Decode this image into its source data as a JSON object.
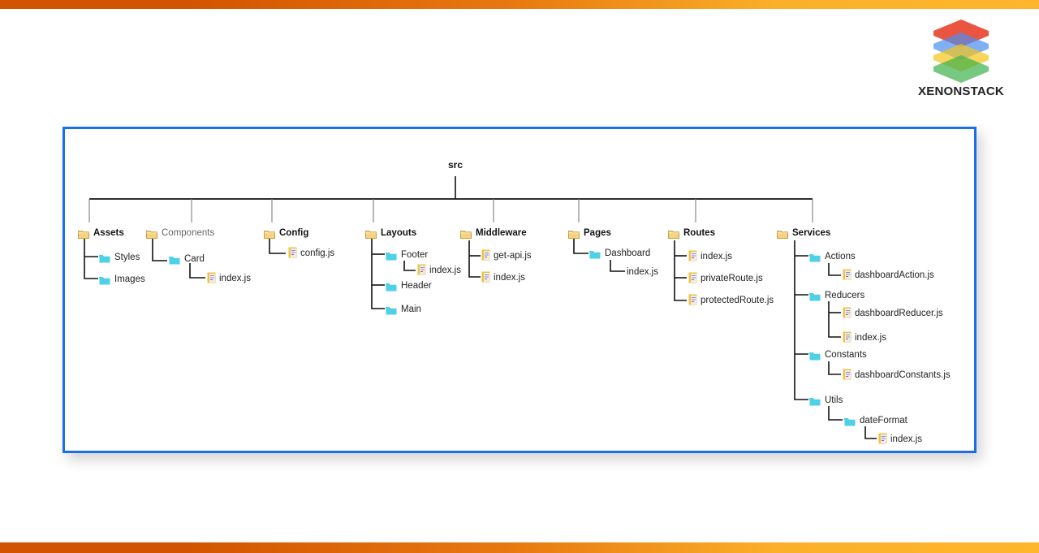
{
  "brand": {
    "name": "XENONSTACK",
    "logo_layers": [
      "#e8432e",
      "#4c8df0",
      "#f5c518",
      "#3db04a"
    ]
  },
  "colors": {
    "frame_border": "#1a6fe8",
    "folder_root": "#f6d27a",
    "folder_sub": "#4dd0e8",
    "file_icon": "#f3c23c",
    "gradient_start": "#d35400",
    "gradient_end": "#ffb52c"
  },
  "tree": {
    "root": "src",
    "nodes": [
      {
        "id": "assets",
        "label": "Assets",
        "type": "folder-root",
        "style": "bold"
      },
      {
        "id": "assets-styles",
        "label": "Styles",
        "type": "folder"
      },
      {
        "id": "assets-images",
        "label": "Images",
        "type": "folder"
      },
      {
        "id": "components",
        "label": "Components",
        "type": "folder-root",
        "style": "muted"
      },
      {
        "id": "components-card",
        "label": "Card",
        "type": "folder"
      },
      {
        "id": "components-card-index",
        "label": "index.js",
        "type": "file"
      },
      {
        "id": "config",
        "label": "Config",
        "type": "folder-root",
        "style": "bold"
      },
      {
        "id": "config-configjs",
        "label": "config.js",
        "type": "file"
      },
      {
        "id": "layouts",
        "label": "Layouts",
        "type": "folder-root",
        "style": "bold"
      },
      {
        "id": "layouts-footer",
        "label": "Footer",
        "type": "folder"
      },
      {
        "id": "layouts-footer-index",
        "label": "index.js",
        "type": "file"
      },
      {
        "id": "layouts-header",
        "label": "Header",
        "type": "folder"
      },
      {
        "id": "layouts-main",
        "label": "Main",
        "type": "folder"
      },
      {
        "id": "middleware",
        "label": "Middleware",
        "type": "folder-root",
        "style": "bold"
      },
      {
        "id": "middleware-getapi",
        "label": "get-api.js",
        "type": "file"
      },
      {
        "id": "middleware-index",
        "label": "index.js",
        "type": "file"
      },
      {
        "id": "pages",
        "label": "Pages",
        "type": "folder-root",
        "style": "bold"
      },
      {
        "id": "pages-dashboard",
        "label": "Dashboard",
        "type": "folder"
      },
      {
        "id": "pages-dashboard-index",
        "label": "index.js",
        "type": "text"
      },
      {
        "id": "routes",
        "label": "Routes",
        "type": "folder-root",
        "style": "bold"
      },
      {
        "id": "routes-index",
        "label": "index.js",
        "type": "file"
      },
      {
        "id": "routes-private",
        "label": "privateRoute.js",
        "type": "file"
      },
      {
        "id": "routes-protected",
        "label": "protectedRoute.js",
        "type": "file"
      },
      {
        "id": "services",
        "label": "Services",
        "type": "folder-root",
        "style": "bold"
      },
      {
        "id": "services-actions",
        "label": "Actions",
        "type": "folder"
      },
      {
        "id": "services-actions-file",
        "label": "dashboardAction.js",
        "type": "file"
      },
      {
        "id": "services-reducers",
        "label": "Reducers",
        "type": "folder"
      },
      {
        "id": "services-reducers-file",
        "label": "dashboardReducer.js",
        "type": "file"
      },
      {
        "id": "services-reducers-index",
        "label": "index.js",
        "type": "file"
      },
      {
        "id": "services-constants",
        "label": "Constants",
        "type": "folder"
      },
      {
        "id": "services-constants-file",
        "label": "dashboardConstants.js",
        "type": "file"
      },
      {
        "id": "services-utils",
        "label": "Utils",
        "type": "folder"
      },
      {
        "id": "services-utils-dateformat",
        "label": "dateFormat",
        "type": "folder"
      },
      {
        "id": "services-utils-dateformat-index",
        "label": "index.js",
        "type": "file"
      }
    ]
  }
}
